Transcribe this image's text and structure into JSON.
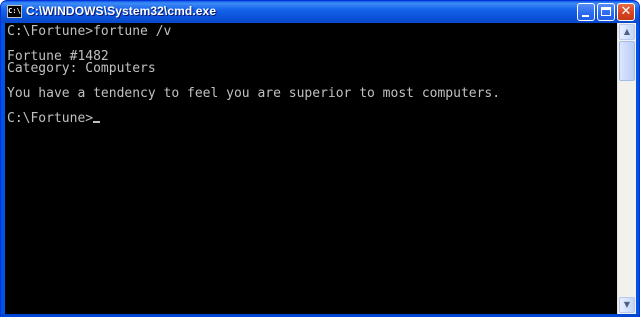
{
  "window": {
    "title": "C:\\WINDOWS\\System32\\cmd.exe",
    "icon_label": "C:\\",
    "icon_name": "cmd-prompt-icon",
    "buttons": {
      "minimize": "minimize-icon",
      "maximize": "maximize-icon",
      "close_glyph": "✕"
    }
  },
  "console": {
    "lines": [
      "C:\\Fortune>fortune /v",
      "",
      "Fortune #1482",
      "Category: Computers",
      "",
      "You have a tendency to feel you are superior to most computers.",
      "",
      "C:\\Fortune>"
    ],
    "text_color": "#c0c0c0",
    "background": "#000000"
  },
  "scrollbar": {
    "up_glyph": "▲",
    "down_glyph": "▼"
  }
}
